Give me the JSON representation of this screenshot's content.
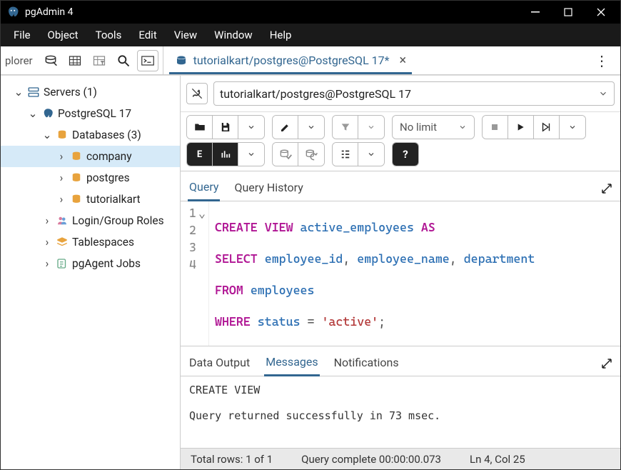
{
  "window": {
    "title": "pgAdmin 4"
  },
  "menubar": [
    "File",
    "Object",
    "Tools",
    "Edit",
    "View",
    "Window",
    "Help"
  ],
  "explorer_label": "plorer",
  "tree": {
    "servers": "Servers (1)",
    "pg": "PostgreSQL 17",
    "databases": "Databases (3)",
    "db_company": "company",
    "db_postgres": "postgres",
    "db_tutorialkart": "tutorialkart",
    "login_roles": "Login/Group Roles",
    "tablespaces": "Tablespaces",
    "pgagent": "pgAgent Jobs"
  },
  "tab": {
    "title": "tutorialkart/postgres@PostgreSQL 17*"
  },
  "conn": {
    "label": "tutorialkart/postgres@PostgreSQL 17"
  },
  "limit_label": "No limit",
  "editor_tabs": {
    "query": "Query",
    "history": "Query History"
  },
  "sql": {
    "l1": {
      "kw1": "CREATE",
      "kw2": "VIEW",
      "ident": "active_employees",
      "kw3": "AS"
    },
    "l2": {
      "kw": "SELECT",
      "c1": "employee_id",
      "c2": "employee_name",
      "c3": "department"
    },
    "l3": {
      "kw": "FROM",
      "t": "employees"
    },
    "l4": {
      "kw": "WHERE",
      "col": "status",
      "eq": "=",
      "val": "'active'",
      "semi": ";"
    },
    "gutter": [
      "1",
      "2",
      "3",
      "4"
    ]
  },
  "out_tabs": {
    "data": "Data Output",
    "messages": "Messages",
    "notifications": "Notifications"
  },
  "messages": {
    "line1": "CREATE VIEW",
    "line2": "Query returned successfully in 73 msec."
  },
  "status": {
    "rows": "Total rows: 1 of 1",
    "time": "Query complete 00:00:00.073",
    "pos": "Ln 4, Col 25"
  }
}
